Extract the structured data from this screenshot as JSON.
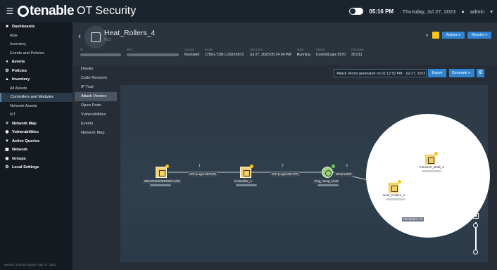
{
  "topbar": {
    "menu_icon": "hamburger-icon",
    "brand": "tenable",
    "product": "OT Security",
    "time": "05:16 PM",
    "date": " · Thursday, Jul 27, 2023",
    "user": "admin"
  },
  "sidebar": {
    "items": [
      {
        "label": "Dashboards",
        "icon": "dashboard-icon",
        "bold": true
      },
      {
        "label": "Risk",
        "sub": true
      },
      {
        "label": "Inventory",
        "sub": true
      },
      {
        "label": "Events and Policies",
        "sub": true
      },
      {
        "label": "Events",
        "icon": "bell-icon",
        "bold": true
      },
      {
        "label": "Policies",
        "icon": "gear-icon",
        "bold": true
      },
      {
        "label": "Inventory",
        "icon": "inventory-icon",
        "bold": true
      },
      {
        "label": "All Assets",
        "sub": true
      },
      {
        "label": "Controllers and Modules",
        "sub": true,
        "selected": true
      },
      {
        "label": "Network Assets",
        "sub": true
      },
      {
        "label": "IoT",
        "sub": true
      },
      {
        "label": "Network Map",
        "icon": "network-map-icon",
        "bold": true
      },
      {
        "label": "Vulnerabilities",
        "icon": "bug-icon",
        "bold": true
      },
      {
        "label": "Active Queries",
        "icon": "shield-icon",
        "bold": true
      },
      {
        "label": "Network",
        "icon": "network-icon",
        "bold": true
      },
      {
        "label": "Groups",
        "icon": "groups-icon",
        "bold": true
      },
      {
        "label": "Local Settings",
        "icon": "settings-icon",
        "bold": true
      }
    ],
    "footer_version": "Version: 3.16.55 Expires Sep 17, 2023"
  },
  "device": {
    "name": "Heat_Rollers_4",
    "subtitle": "PLC",
    "vendor": "Rockwell",
    "model": "1756-L71/B LOGIX5571",
    "last_seen": "Jul 27, 2023 05:14:34 PM",
    "state": "Running",
    "family": "ControlLogix 5570",
    "firmware": "30.011"
  },
  "device_labels": {
    "ip": "IP",
    "mac": "MAC",
    "vendor": "Vendor",
    "model": "Model",
    "last_seen": "Last Seen",
    "state": "State",
    "family": "Family",
    "firmware": "Firmware"
  },
  "header_buttons": {
    "actions": "Actions",
    "resolve": "Resolve"
  },
  "subnav": [
    "Details",
    "Code Revision",
    "IP Trail",
    "Attack Vectors",
    "Open Ports",
    "Vulnerabilities",
    "Events",
    "Network Map"
  ],
  "toolbar": {
    "generated_text": "Attack Vector generated on 01:12:52 PM · Jul 27, 2023",
    "export": "Export",
    "generate": "Generate",
    "settings_icon": "gear-icon"
  },
  "attack_path": {
    "steps": [
      "1",
      "2",
      "3"
    ],
    "nodes": [
      {
        "label": "WIN-ENGINEERING-WS",
        "status": "yellow"
      },
      {
        "label": "Controller_1",
        "status": "yellow"
      },
      {
        "label": "Eng_Jump_Host",
        "status": "green"
      },
      {
        "label": "Heat_Rollers_4",
        "status": "yellow"
      },
      {
        "label": "Intrusion_Mold_3",
        "status": "yellow"
      }
    ],
    "link_labels": [
      "CIP (Logix 5571/P)",
      "CIP (Logix 5571/P)",
      "Ethernet/IP",
      "Backplane #1"
    ],
    "backplane_label": "Backplane #1"
  },
  "colors": {
    "accent": "#2f83d0",
    "warning": "#f5c518",
    "ok": "#6bd05a",
    "sidebar_bg": "#141a20"
  }
}
